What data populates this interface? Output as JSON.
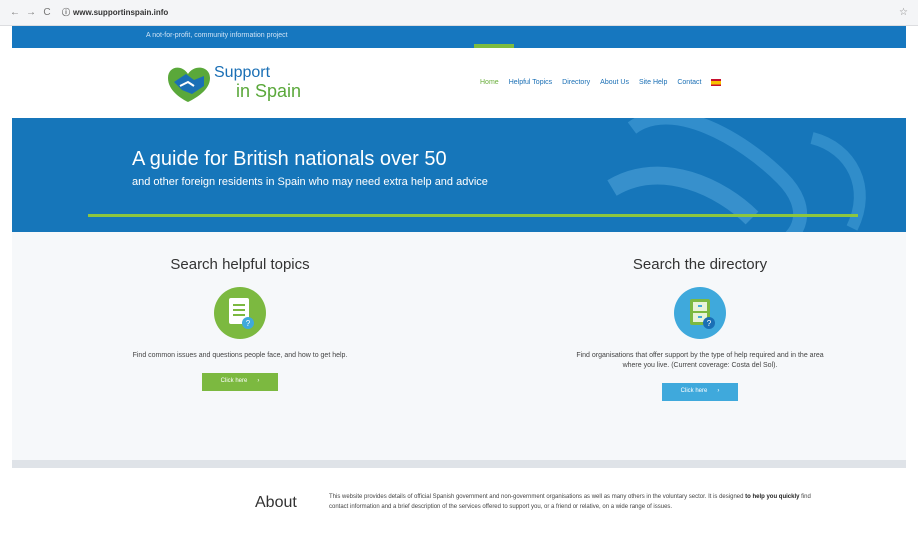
{
  "browser": {
    "back": "←",
    "forward": "→",
    "reload": "C",
    "url": "www.supportinspain.info"
  },
  "topbar": {
    "tagline": "A not-for-profit, community information project"
  },
  "brand": {
    "line1": "Support",
    "line2": "in Spain"
  },
  "nav": {
    "items": [
      "Home",
      "Helpful Topics",
      "Directory",
      "About Us",
      "Site Help",
      "Contact"
    ],
    "active": "Home"
  },
  "hero": {
    "title": "A guide for British nationals over 50",
    "subtitle": "and other foreign residents in Spain who may need extra help and advice"
  },
  "topics": {
    "title": "Search helpful topics",
    "description": "Find common issues and questions people face, and how to get help.",
    "button": "Click here",
    "color": "#7cb940"
  },
  "directory": {
    "title": "Search the directory",
    "description": "Find organisations that offer support by the type of help required and in the area where you live. (Current coverage: Costa del Sol).",
    "button": "Click here",
    "color": "#3fa9dc"
  },
  "about": {
    "heading": "About",
    "text_before": "This website provides details of official Spanish government and non-government organisations as well as many others in the voluntary sector. It is designed",
    "text_bold": "to help you quickly",
    "text_after": "find contact information and a brief description of the services offered to support you, or a friend or relative, on a wide range of issues."
  },
  "colors": {
    "primary_blue": "#1676ba",
    "accent_green": "#8dc63f"
  }
}
